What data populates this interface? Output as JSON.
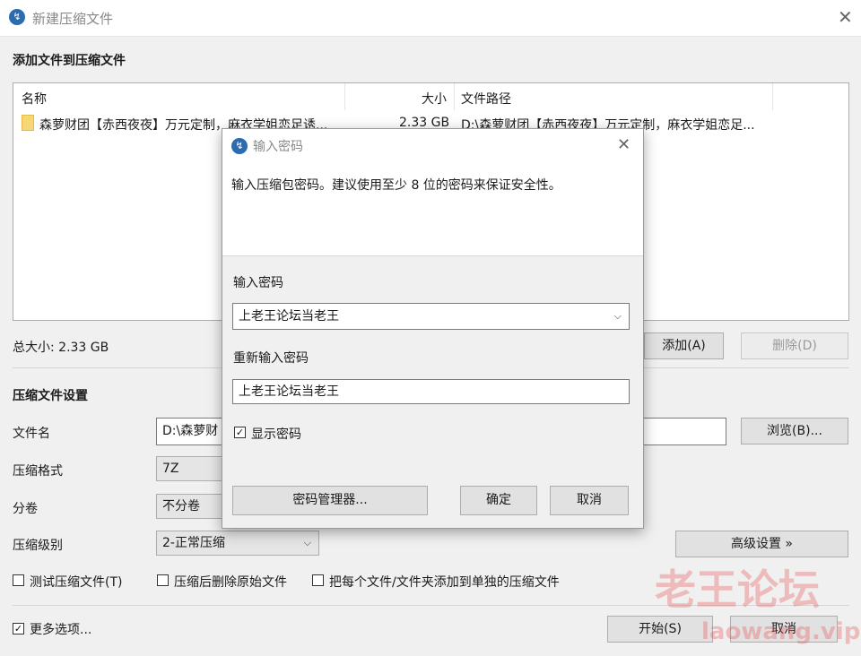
{
  "window": {
    "title": "新建压缩文件"
  },
  "files": {
    "section_title": "添加文件到压缩文件",
    "columns": {
      "name": "名称",
      "size": "大小",
      "path": "文件路径"
    },
    "rows": [
      {
        "name": "森萝财团【赤西夜夜】万元定制，麻衣学姐恋足诱...",
        "size": "2.33 GB",
        "path": "D:\\森萝财团【赤西夜夜】万元定制，麻衣学姐恋足..."
      }
    ],
    "total_size": "总大小: 2.33 GB",
    "add_label": "添加(A)",
    "delete_label": "删除(D)"
  },
  "settings": {
    "section_title": "压缩文件设置",
    "filename_label": "文件名",
    "filename_value": "D:\\森萝财",
    "browse_label": "浏览(B)...",
    "format_label": "压缩格式",
    "format_value": "7Z",
    "split_label": "分卷",
    "split_value": "不分卷",
    "level_label": "压缩级别",
    "level_value": "2-正常压缩",
    "advanced_label": "高级设置 »",
    "test_label": "测试压缩文件(T)",
    "delete_after_label": "压缩后删除原始文件",
    "separate_label": "把每个文件/文件夹添加到单独的压缩文件"
  },
  "footer": {
    "more_options": "更多选项...",
    "start_label": "开始(S)",
    "cancel_label": "取消"
  },
  "dialog": {
    "title": "输入密码",
    "description": "输入压缩包密码。建议使用至少 8 位的密码来保证安全性。",
    "password_label": "输入密码",
    "password_value": "上老王论坛当老王",
    "reenter_label": "重新输入密码",
    "reenter_value": "上老王论坛当老王",
    "show_password": "显示密码",
    "manager_label": "密码管理器...",
    "ok_label": "确定",
    "cancel_label": "取消"
  },
  "watermark": {
    "cn": "老王论坛",
    "en": "laowang.vip"
  },
  "icons": [
    "app-icon",
    "close-icon",
    "folder-icon",
    "chevron-down-icon",
    "check-icon"
  ]
}
